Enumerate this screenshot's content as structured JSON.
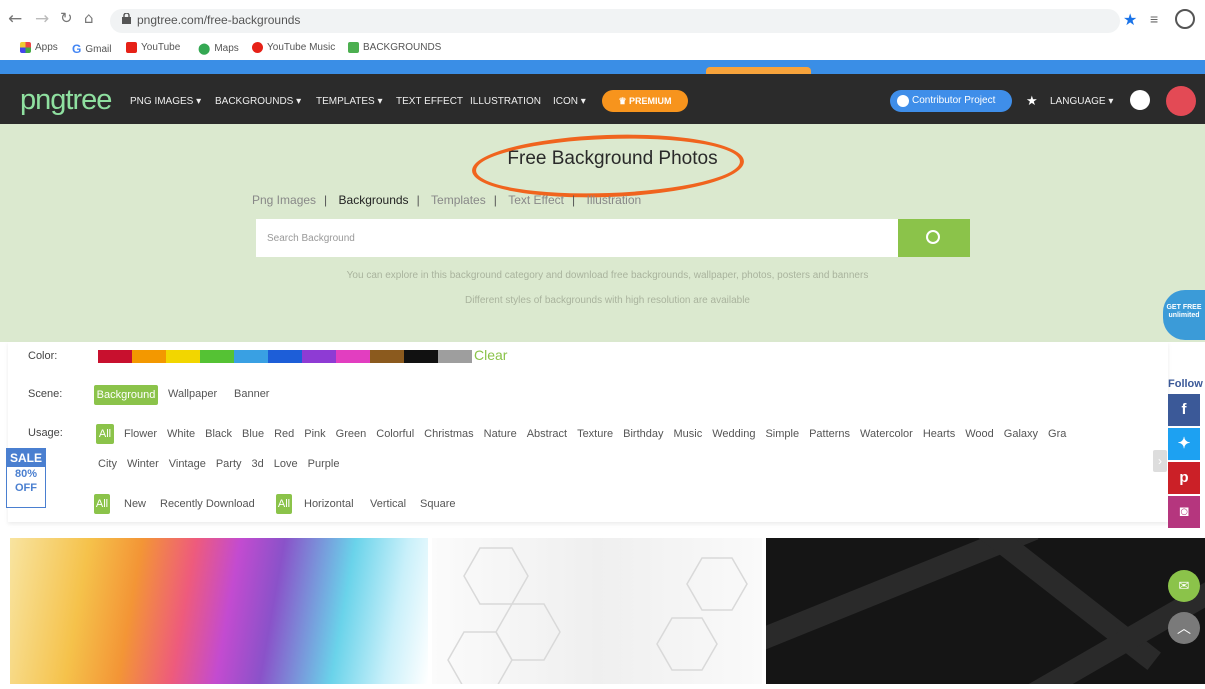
{
  "browser": {
    "url": "pngtree.com/free-backgrounds",
    "bookmarks": [
      "Apps",
      "Gmail",
      "YouTube",
      "Maps",
      "YouTube Music",
      "BACKGROUNDS"
    ]
  },
  "site_nav": {
    "logo": "pngtree",
    "items": [
      "PNG IMAGES ▾",
      "BACKGROUNDS ▾",
      "TEMPLATES ▾",
      "TEXT EFFECT",
      "ILLUSTRATION",
      "ICON ▾"
    ],
    "premium": "PREMIUM",
    "contributor": "Contributor Project",
    "language": "LANGUAGE ▾"
  },
  "hero": {
    "title": "Free Background Photos",
    "tabs": [
      "Png Images",
      "Backgrounds",
      "Templates",
      "Text Effect",
      "Illustration"
    ],
    "active_tab": "Backgrounds",
    "search_placeholder": "Search Background",
    "desc_line1": "You can explore in this background category and download free backgrounds, wallpaper, photos, posters and banners",
    "desc_line2": "Different styles of backgrounds with high resolution are available"
  },
  "filters": {
    "color_label": "Color:",
    "colors": [
      "#c8102e",
      "#f39800",
      "#f2d600",
      "#55c234",
      "#39a0e3",
      "#1d5ed8",
      "#8e3bd4",
      "#e23ec0",
      "#8b5a1e",
      "#111111",
      "#9e9e9e",
      "#ffffff"
    ],
    "clear_label": "Clear",
    "scene_label": "Scene:",
    "scene_options": [
      "Background",
      "Wallpaper",
      "Banner"
    ],
    "usage_label": "Usage:",
    "usage_all": "All",
    "usage_row1": [
      "Flower",
      "White",
      "Black",
      "Blue",
      "Red",
      "Pink",
      "Green",
      "Colorful",
      "Christmas",
      "Nature",
      "Abstract",
      "Texture",
      "Birthday",
      "Music",
      "Wedding",
      "Simple",
      "Patterns",
      "Watercolor",
      "Hearts",
      "Wood",
      "Galaxy",
      "Gra"
    ],
    "usage_row2": [
      "City",
      "Winter",
      "Vintage",
      "Party",
      "3d",
      "Love",
      "Purple"
    ],
    "sort_all": "All",
    "sort_options": [
      "New",
      "Recently Download"
    ],
    "orient_all": "All",
    "orient_options": [
      "Horizontal",
      "Vertical",
      "Square"
    ]
  },
  "sale": {
    "top": "SALE",
    "pct": "80%",
    "off": "OFF"
  },
  "social": {
    "badge": "GET FREE unlimited",
    "follow": "Follow"
  }
}
